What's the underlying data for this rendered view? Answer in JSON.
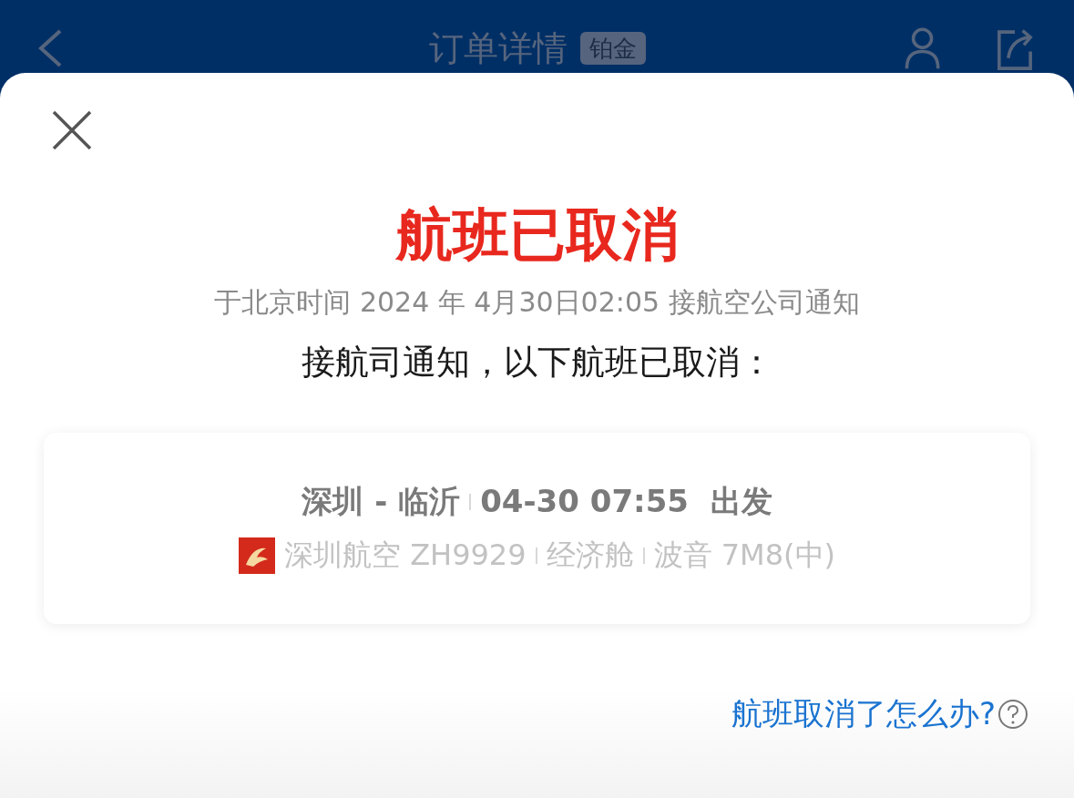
{
  "header": {
    "title": "订单详情",
    "badge": "铂金"
  },
  "dialog": {
    "title": "航班已取消",
    "notice_time": "于北京时间 2024 年 4月30日02:05 接航空公司通知",
    "message": "接航司通知，以下航班已取消：",
    "flight": {
      "route_line": [
        "深圳 - 临沂",
        "04-30 07:55  出发"
      ],
      "detail_line": [
        "深圳航空 ZH9929",
        "经济舱",
        "波音 7M8(中)"
      ]
    },
    "help_link": "航班取消了怎么办?"
  }
}
